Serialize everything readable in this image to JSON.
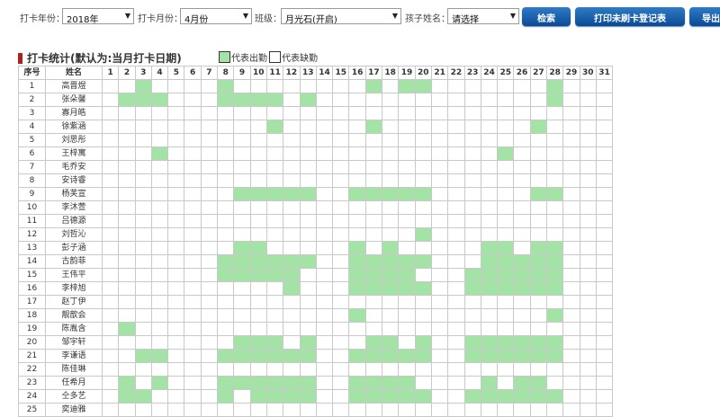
{
  "filters": {
    "year_label": "打卡年份：",
    "year_value": "2018年",
    "month_label": "打卡月份：",
    "month_value": "4月份",
    "class_label": "班级：",
    "class_value": "月光石(开启)",
    "child_label": "孩子姓名：",
    "child_value": "请选择",
    "search_button": "检索",
    "print_button": "打印未刷卡登记表",
    "export_button": "导出数"
  },
  "section": {
    "title": "打卡统计(默认为:当月打卡日期)",
    "legend_present": "代表出勤",
    "legend_absent": "代表缺勤",
    "present_color": "#a3e4a6"
  },
  "table": {
    "header_seq": "序号",
    "header_name": "姓名",
    "days": [
      "1",
      "2",
      "3",
      "4",
      "5",
      "6",
      "7",
      "8",
      "9",
      "10",
      "11",
      "12",
      "13",
      "14",
      "15",
      "16",
      "17",
      "18",
      "19",
      "20",
      "21",
      "22",
      "23",
      "24",
      "25",
      "26",
      "27",
      "28",
      "29",
      "30",
      "31"
    ],
    "rows": [
      {
        "seq": "1",
        "name": "高晋煜",
        "present": [
          3,
          8,
          17,
          19,
          20,
          28
        ]
      },
      {
        "seq": "2",
        "name": "张朵馨",
        "present": [
          2,
          3,
          4,
          8,
          9,
          10,
          11,
          13,
          28
        ]
      },
      {
        "seq": "3",
        "name": "寡月皓",
        "present": []
      },
      {
        "seq": "4",
        "name": "徐紫涵",
        "present": [
          11,
          17,
          27
        ]
      },
      {
        "seq": "5",
        "name": "刘思彤",
        "present": []
      },
      {
        "seq": "6",
        "name": "王梓寓",
        "present": [
          4,
          25
        ]
      },
      {
        "seq": "7",
        "name": "毛乔安",
        "present": []
      },
      {
        "seq": "8",
        "name": "安诗睿",
        "present": []
      },
      {
        "seq": "9",
        "name": "杨芙宣",
        "present": [
          9,
          10,
          11,
          12,
          13,
          16,
          17,
          18,
          19,
          20,
          27,
          28
        ]
      },
      {
        "seq": "10",
        "name": "李沐萱",
        "present": []
      },
      {
        "seq": "11",
        "name": "吕德源",
        "present": []
      },
      {
        "seq": "12",
        "name": "刘哲沁",
        "present": [
          20
        ]
      },
      {
        "seq": "13",
        "name": "彭子涵",
        "present": [
          9,
          10,
          16,
          18,
          24,
          25,
          27,
          28
        ]
      },
      {
        "seq": "14",
        "name": "古韵菲",
        "present": [
          8,
          9,
          10,
          11,
          12,
          13,
          16,
          17,
          18,
          19,
          20,
          24,
          25,
          26,
          27,
          28
        ]
      },
      {
        "seq": "15",
        "name": "王伟平",
        "present": [
          8,
          9,
          10,
          11,
          12,
          16,
          17,
          18,
          19,
          23,
          24,
          25,
          26,
          27,
          28
        ]
      },
      {
        "seq": "16",
        "name": "李梓旭",
        "present": [
          12,
          16,
          17,
          18,
          19,
          20,
          23,
          24,
          25,
          26,
          27,
          28
        ]
      },
      {
        "seq": "17",
        "name": "赵丁伊",
        "present": []
      },
      {
        "seq": "18",
        "name": "靓歆会",
        "present": [
          16,
          28
        ]
      },
      {
        "seq": "19",
        "name": "陈胤含",
        "present": [
          2
        ]
      },
      {
        "seq": "20",
        "name": "邹宇轩",
        "present": [
          9,
          10,
          11,
          13,
          17,
          18,
          20,
          23,
          24,
          25,
          26,
          27,
          28
        ]
      },
      {
        "seq": "21",
        "name": "李谦语",
        "present": [
          3,
          4,
          8,
          9,
          10,
          11,
          12,
          13,
          16,
          17,
          18,
          19,
          20,
          23,
          24,
          25,
          26,
          27,
          28
        ]
      },
      {
        "seq": "22",
        "name": "陈佳琳",
        "present": []
      },
      {
        "seq": "23",
        "name": "任希月",
        "present": [
          2,
          4,
          8,
          9,
          10,
          11,
          12,
          13,
          16,
          17,
          18,
          19,
          24,
          26,
          27
        ]
      },
      {
        "seq": "24",
        "name": "仝多艺",
        "present": [
          2,
          3,
          8,
          10,
          11,
          12,
          13,
          16,
          17,
          18,
          19,
          20,
          23,
          24,
          25,
          26,
          27,
          28
        ]
      },
      {
        "seq": "25",
        "name": "奕迪雅",
        "present": []
      }
    ]
  }
}
